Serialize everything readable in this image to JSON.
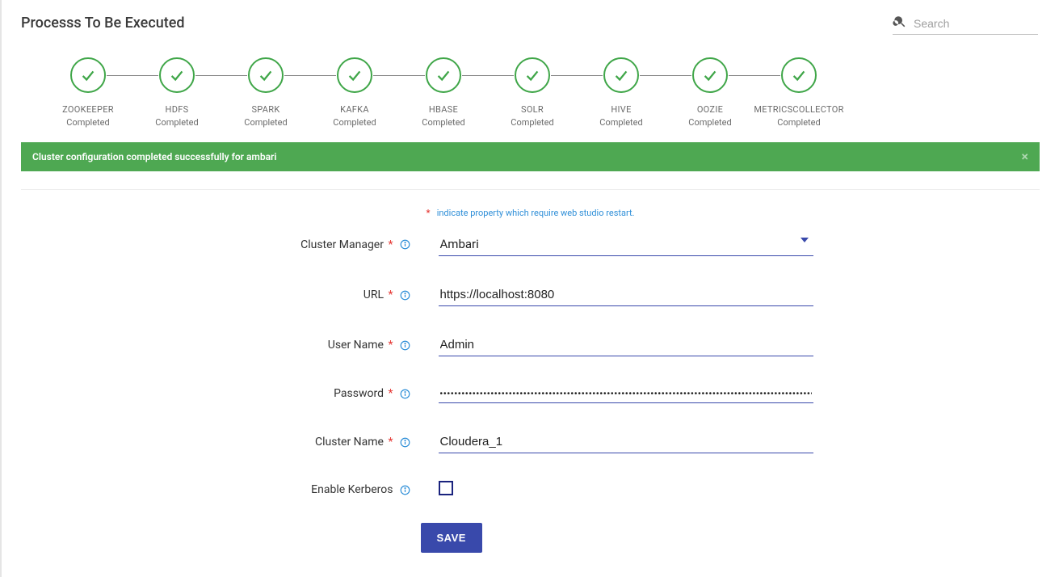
{
  "page_title": "Processs To Be Executed",
  "search": {
    "placeholder": "Search"
  },
  "steps": [
    {
      "label": "ZOOKEEPER",
      "status": "Completed"
    },
    {
      "label": "HDFS",
      "status": "Completed"
    },
    {
      "label": "SPARK",
      "status": "Completed"
    },
    {
      "label": "KAFKA",
      "status": "Completed"
    },
    {
      "label": "HBASE",
      "status": "Completed"
    },
    {
      "label": "SOLR",
      "status": "Completed"
    },
    {
      "label": "HIVE",
      "status": "Completed"
    },
    {
      "label": "OOZIE",
      "status": "Completed"
    },
    {
      "label": "METRICSCOLLECTOR",
      "status": "Completed"
    }
  ],
  "alert": {
    "message": "Cluster configuration completed successfully for ambari",
    "close_glyph": "×"
  },
  "hint": {
    "star": "*",
    "text": "indicate property which require web studio restart."
  },
  "form": {
    "cluster_manager": {
      "label": "Cluster Manager",
      "required": true,
      "value": "Ambari"
    },
    "url": {
      "label": "URL",
      "required": true,
      "value": "https://localhost:8080"
    },
    "user_name": {
      "label": "User Name",
      "required": true,
      "value": "Admin"
    },
    "password": {
      "label": "Password",
      "required": true,
      "value": "••••••••••••••••••••••••••••••••••••••••••••••••••••••••••••••••••••••••••••••••••••••••••••••••••••••••••••••••"
    },
    "cluster_name": {
      "label": "Cluster Name",
      "required": true,
      "value": "Cloudera_1"
    },
    "enable_kerberos": {
      "label": "Enable Kerberos",
      "required": false,
      "checked": false
    }
  },
  "buttons": {
    "save": "SAVE"
  }
}
